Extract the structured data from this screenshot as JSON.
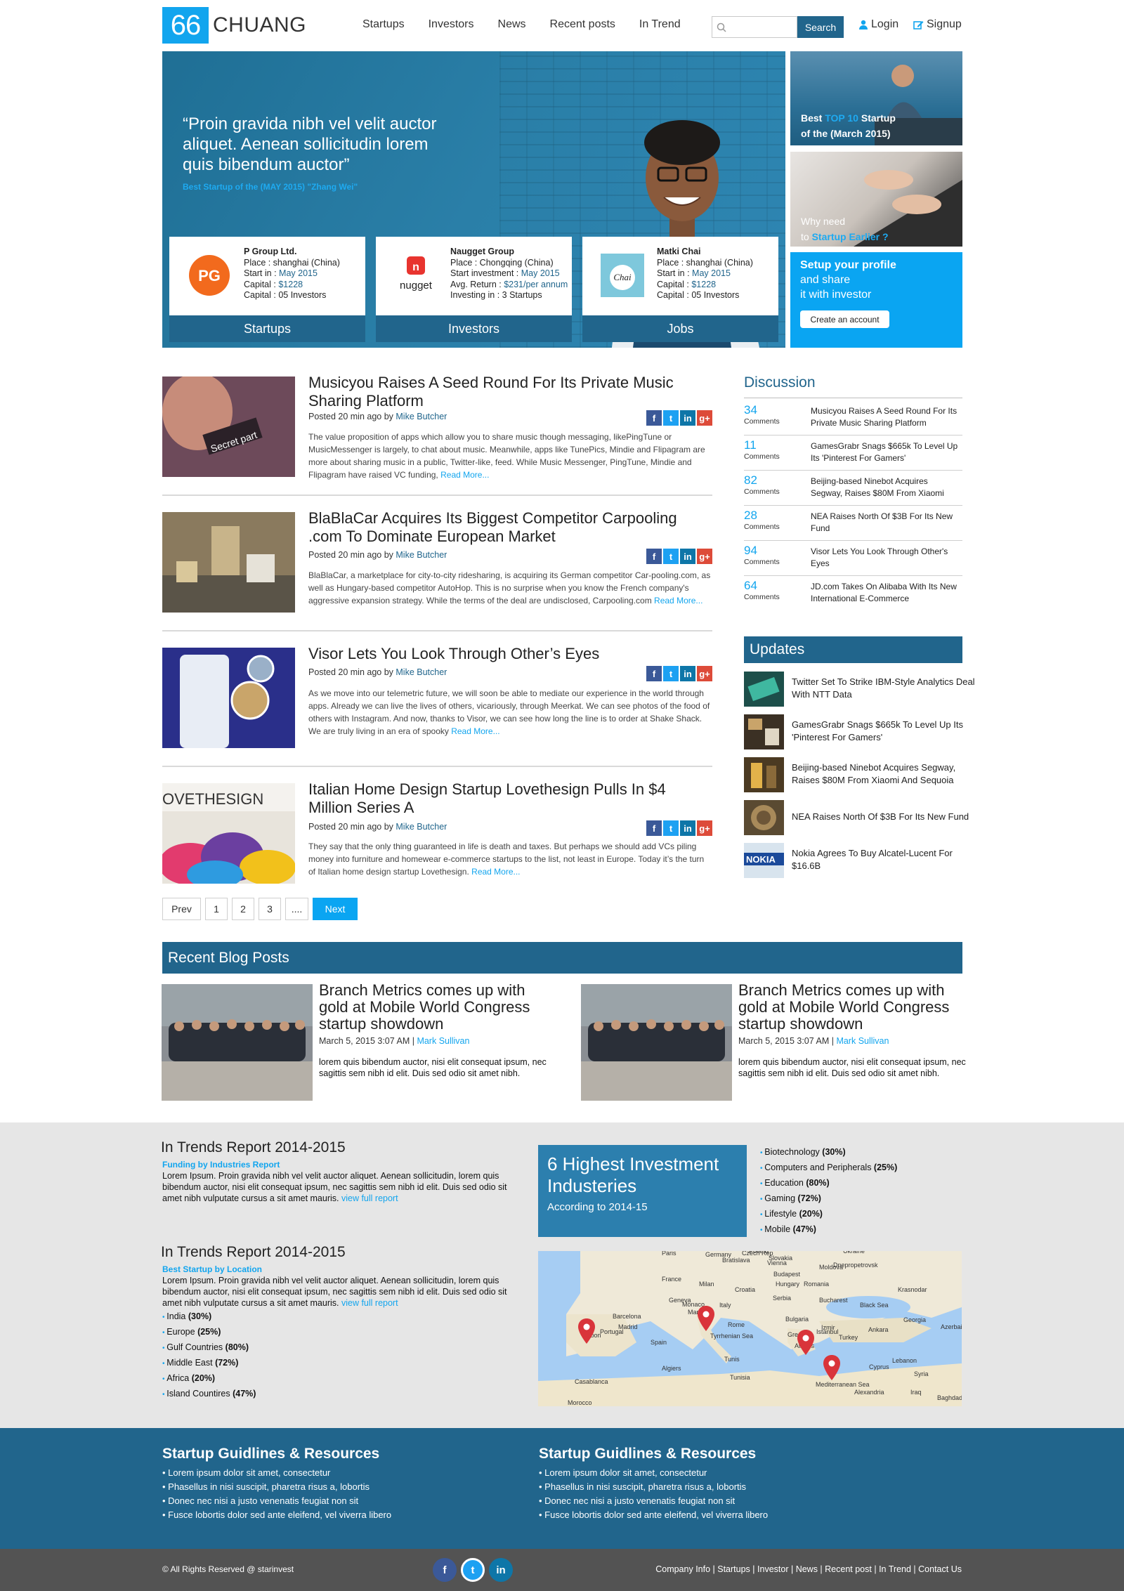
{
  "header": {
    "logo_number": "66",
    "logo_text": "CHUANG",
    "nav": [
      "Startups",
      "Investors",
      "News",
      "Recent posts",
      "In Trend"
    ],
    "search_button": "Search",
    "search_placeholder": "",
    "login": "Login",
    "signup": "Signup"
  },
  "hero": {
    "quote": "“Proin gravida nibh vel velit auctor aliquet. Aenean sollicitudin lorem quis bibendum auctor”",
    "credit": "Best Startup of the (MAY 2015) \"Zhang Wei\"",
    "cards": [
      {
        "name": "P Group Ltd.",
        "lines": [
          "Place : shanghai (China)",
          "Start in : ",
          "Capital : ",
          "Capital  : 05 Investors"
        ],
        "start": "May 2015",
        "capital": "$1228",
        "tab": "Startups"
      },
      {
        "name": "Naugget Group",
        "lines": [
          "Place : Chongqing (China)",
          "Start investment : ",
          "Avg. Return : ",
          "Investing in : 3 Startups"
        ],
        "start": "May 2015",
        "capital": "$231/per annum",
        "tab": "Investors"
      },
      {
        "name": "Matki Chai",
        "lines": [
          "Place : shanghai (China)",
          "Start in : ",
          "Capital : ",
          "Capital  : 05 Investors"
        ],
        "start": "May 2015",
        "capital": "$1228",
        "tab": "Jobs"
      }
    ],
    "side1": {
      "a": "Best ",
      "b": "TOP 10",
      "c": " Startup",
      "d": "of the (March 2015)"
    },
    "side2": {
      "a": "Why need",
      "b": "to ",
      "c": "Startup Earlier ?"
    },
    "side3": {
      "title": "Setup your profile",
      "l1": "and share",
      "l2": "it with investor",
      "button": "Create an account"
    }
  },
  "articles": [
    {
      "title": "Musicyou Raises A Seed Round For Its Private Music Sharing Platform",
      "posted": "Posted 20 min ago by ",
      "author": "Mike Butcher",
      "desc": "The value proposition of apps which allow you to share music though messaging, likePingTune or MusicMessenger is largely, to chat about music. Meanwhile, apps like TunePics, Mindie and Flipagram are more about sharing music in a public, Twitter-like, feed. While Music Messenger, PingTune, Mindie and Flipagram have raised VC funding, ",
      "more": "Read More..."
    },
    {
      "title": "BlaBlaCar Acquires Its Biggest Competitor Carpooling .com To Dominate European Market",
      "posted": "Posted 20 min ago by ",
      "author": "Mike Butcher",
      "desc": "BlaBlaCar, a marketplace for city-to-city ridesharing, is acquiring its German competitor Car-pooling.com, as well as Hungary-based competitor AutoHop. This is no surprise when you know the French company's aggressive expansion strategy. While the terms of the deal are undisclosed, Carpooling.com ",
      "more": "Read More..."
    },
    {
      "title": "Visor Lets You Look Through Other’s Eyes",
      "posted": "Posted 20 min ago by ",
      "author": "Mike Butcher",
      "desc": "As we move into our telemetric future, we will soon be able to mediate our experience in the world through apps. Already we can live the lives of others, vicariously, through Meerkat. We can see photos of the food of others with Instagram. And now, thanks to Visor, we can see how long the line is to order at Shake Shack. We are truly living in an era of spooky ",
      "more": "Read More..."
    },
    {
      "title": "Italian Home Design Startup Lovethesign Pulls In $4 Million Series A",
      "posted": "Posted 20 min ago by ",
      "author": "Mike Butcher",
      "desc": "They say that the only thing guaranteed in life is death and taxes. But perhaps we should add VCs piling money into furniture and homewear e-commerce startups to the list, not least in Europe. Today it’s the turn of Italian home design startup Lovethesign. ",
      "more": "Read More..."
    }
  ],
  "pager": {
    "prev": "Prev",
    "pages": [
      "1",
      "2",
      "3",
      "...."
    ],
    "next": "Next"
  },
  "discussion": {
    "title": "Discussion",
    "comments_label": "Comments",
    "items": [
      {
        "count": "34",
        "title": "Musicyou Raises A Seed Round For Its Private Music Sharing Platform"
      },
      {
        "count": "11",
        "title": "GamesGrabr Snags $665k To Level Up Its 'Pinterest For Gamers'"
      },
      {
        "count": "82",
        "title": "Beijing-based Ninebot Acquires Segway, Raises $80M From Xiaomi"
      },
      {
        "count": "28",
        "title": "NEA Raises North Of $3B For Its New Fund"
      },
      {
        "count": "94",
        "title": "Visor Lets You Look Through Other's Eyes"
      },
      {
        "count": "64",
        "title": "JD.com Takes On Alibaba With Its New International E-Commerce"
      }
    ]
  },
  "updates": {
    "title": "Updates",
    "items": [
      "Twitter Set To Strike IBM-Style Analytics Deal With NTT Data",
      "GamesGrabr Snags $665k To Level Up Its 'Pinterest For Gamers'",
      "Beijing-based Ninebot Acquires Segway, Raises $80M From Xiaomi And Sequoia",
      "NEA Raises North Of $3B For Its New Fund",
      "Nokia Agrees To Buy Alcatel-Lucent For $16.6B"
    ]
  },
  "recent_blog": {
    "title": "Recent Blog Posts",
    "posts": [
      {
        "title": "Branch Metrics comes up with gold at Mobile World Congress startup showdown",
        "date": "March 5, 2015 3:07 AM | ",
        "author": "Mark Sullivan",
        "text": "lorem quis bibendum auctor, nisi elit consequat ipsum, nec sagittis sem nibh id elit. Duis sed odio sit amet nibh."
      },
      {
        "title": "Branch Metrics comes up with gold at Mobile World Congress startup showdown",
        "date": "March 5, 2015 3:07 AM | ",
        "author": "Mark Sullivan",
        "text": "lorem quis bibendum auctor, nisi elit consequat ipsum, nec sagittis sem nibh id elit. Duis sed odio sit amet nibh."
      }
    ]
  },
  "trends": {
    "report1": {
      "title": "In Trends Report 2014-2015",
      "sub": "Funding by Industries Report",
      "text": "Lorem Ipsum. Proin gravida nibh vel velit auctor aliquet. Aenean sollicitudin, lorem quis bibendum auctor, nisi elit consequat ipsum, nec sagittis sem nibh id elit. Duis sed odio sit amet nibh vulputate cursus a sit amet mauris. ",
      "link": "view full report"
    },
    "report2": {
      "title": "In Trends Report 2014-2015",
      "sub": "Best Startup by Location",
      "text": "Lorem Ipsum. Proin gravida nibh vel velit auctor aliquet. Aenean sollicitudin, lorem quis bibendum auctor, nisi elit consequat ipsum, nec sagittis sem nibh id elit. Duis sed odio sit amet nibh vulputate cursus a sit amet mauris. ",
      "link": "view full report"
    },
    "locations": [
      {
        "name": "India ",
        "pct": "(30%)"
      },
      {
        "name": "Europe ",
        "pct": "(25%)"
      },
      {
        "name": "Gulf Countries ",
        "pct": "(80%)"
      },
      {
        "name": "Middle East ",
        "pct": "(72%)"
      },
      {
        "name": "Africa ",
        "pct": "(20%)"
      },
      {
        "name": "Island Countires ",
        "pct": "(47%)"
      }
    ],
    "invest_title": "6 Highest Investment Industeries",
    "invest_sub": "According to 2014-15",
    "industries": [
      {
        "name": "Biotechnology ",
        "pct": "(30%)"
      },
      {
        "name": "Computers and Peripherals ",
        "pct": "(25%)"
      },
      {
        "name": "Education ",
        "pct": "(80%)"
      },
      {
        "name": "Gaming ",
        "pct": "(72%)"
      },
      {
        "name": "Lifestyle ",
        "pct": "(20%)"
      },
      {
        "name": "Mobile ",
        "pct": "(47%)"
      }
    ],
    "map_labels": [
      "France",
      "Paris",
      "Germany",
      "Poland",
      "Ukraine",
      "Czech Rep",
      "Slovakia",
      "Bratislava",
      "Budapest",
      "Hungary",
      "Moldova",
      "Dnepropetrovsk",
      "Romania",
      "Bucharest",
      "Bulgaria",
      "Serbia",
      "Croatia",
      "Italy",
      "Rome",
      "Spain",
      "Madrid",
      "Barcelona",
      "Portugal",
      "Lisbon",
      "Greece",
      "Athens",
      "Turkey",
      "Istanbul",
      "Ankara",
      "Black Sea",
      "Georgia",
      "Azerbai",
      "Algiers",
      "Tunisia",
      "Tyrrhenian Sea",
      "Mediterranean Sea",
      "Casablanca",
      "Morocco",
      "Syria",
      "Lebanon",
      "Iraq",
      "Alexandria",
      "Baghdad",
      "Krasnodar",
      "Izmir",
      "Geneva",
      "Vienna",
      "Milan",
      "Marseille",
      "Tunis",
      "Cyprus",
      "Monaco"
    ]
  },
  "resources": {
    "title": "Startup Guidlines & Resources",
    "items": [
      "Lorem ipsum dolor sit amet, consectetur",
      "Phasellus in nisi suscipit, pharetra risus a, lobortis",
      "Donec nec nisi a justo venenatis feugiat non sit",
      "Fusce lobortis dolor sed ante eleifend, vel viverra libero"
    ]
  },
  "footer": {
    "copyright": "© All Rights Reserved @ starinvest",
    "links": [
      "Company Info",
      "Startups",
      "Investor",
      "News",
      "Recent post",
      "In Trend",
      "Contact Us"
    ]
  },
  "colors": {
    "accent": "#12a5ee",
    "dark_blue": "#21658c",
    "footer": "#535353"
  }
}
